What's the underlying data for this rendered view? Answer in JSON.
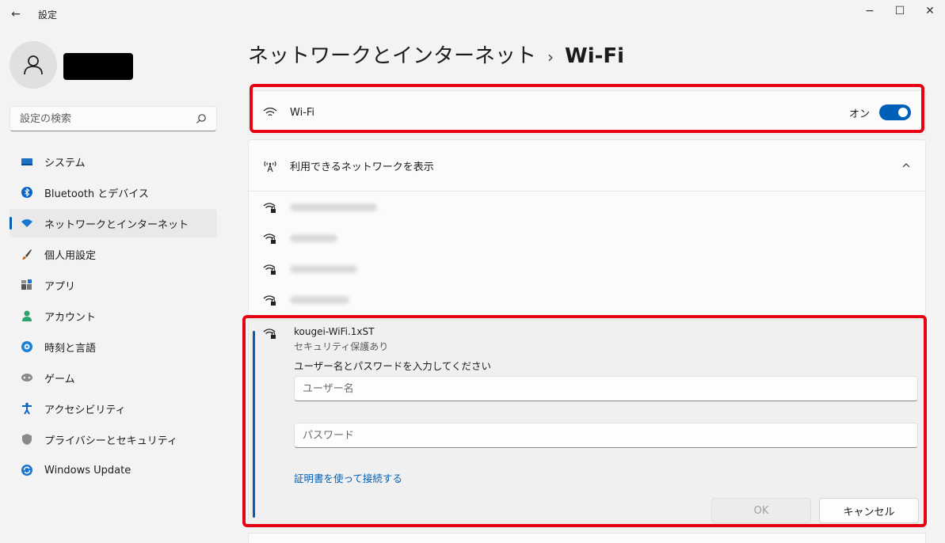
{
  "window": {
    "title": "設定",
    "back_icon": "←",
    "minimize": "−",
    "maximize": "☐",
    "close": "✕"
  },
  "sidebar": {
    "search_placeholder": "設定の検索",
    "items": [
      {
        "label": "システム",
        "icon": "system-icon",
        "color": "#1e6fc6"
      },
      {
        "label": "Bluetooth とデバイス",
        "icon": "bluetooth-icon",
        "color": "#0a66c2"
      },
      {
        "label": "ネットワークとインターネット",
        "icon": "network-icon",
        "color": "#1676d2",
        "active": true
      },
      {
        "label": "個人用設定",
        "icon": "brush-icon",
        "color": "#c46a1a"
      },
      {
        "label": "アプリ",
        "icon": "apps-icon",
        "color": "#666"
      },
      {
        "label": "アカウント",
        "icon": "account-icon",
        "color": "#2fa36b"
      },
      {
        "label": "時刻と言語",
        "icon": "globe-icon",
        "color": "#1a7fd1"
      },
      {
        "label": "ゲーム",
        "icon": "gamepad-icon",
        "color": "#7a7a7a"
      },
      {
        "label": "アクセシビリティ",
        "icon": "accessibility-icon",
        "color": "#0a66c2"
      },
      {
        "label": "プライバシーとセキュリティ",
        "icon": "shield-icon",
        "color": "#7a7a7a"
      },
      {
        "label": "Windows Update",
        "icon": "update-icon",
        "color": "#1a73d0"
      }
    ]
  },
  "main": {
    "breadcrumb_parent": "ネットワークとインターネット",
    "breadcrumb_sep": "›",
    "breadcrumb_current": "Wi-Fi",
    "wifi_label": "Wi-Fi",
    "wifi_state": "オン",
    "show_networks_label": "利用できるネットワークを表示",
    "expanded": {
      "ssid": "kougei-WiFi.1xST",
      "security": "セキュリティ保護あり",
      "prompt": "ユーザー名とパスワードを入力してください",
      "username_placeholder": "ユーザー名",
      "password_placeholder": "パスワード",
      "cert_link": "証明書を使って接続する",
      "ok": "OK",
      "cancel": "キャンセル"
    }
  }
}
